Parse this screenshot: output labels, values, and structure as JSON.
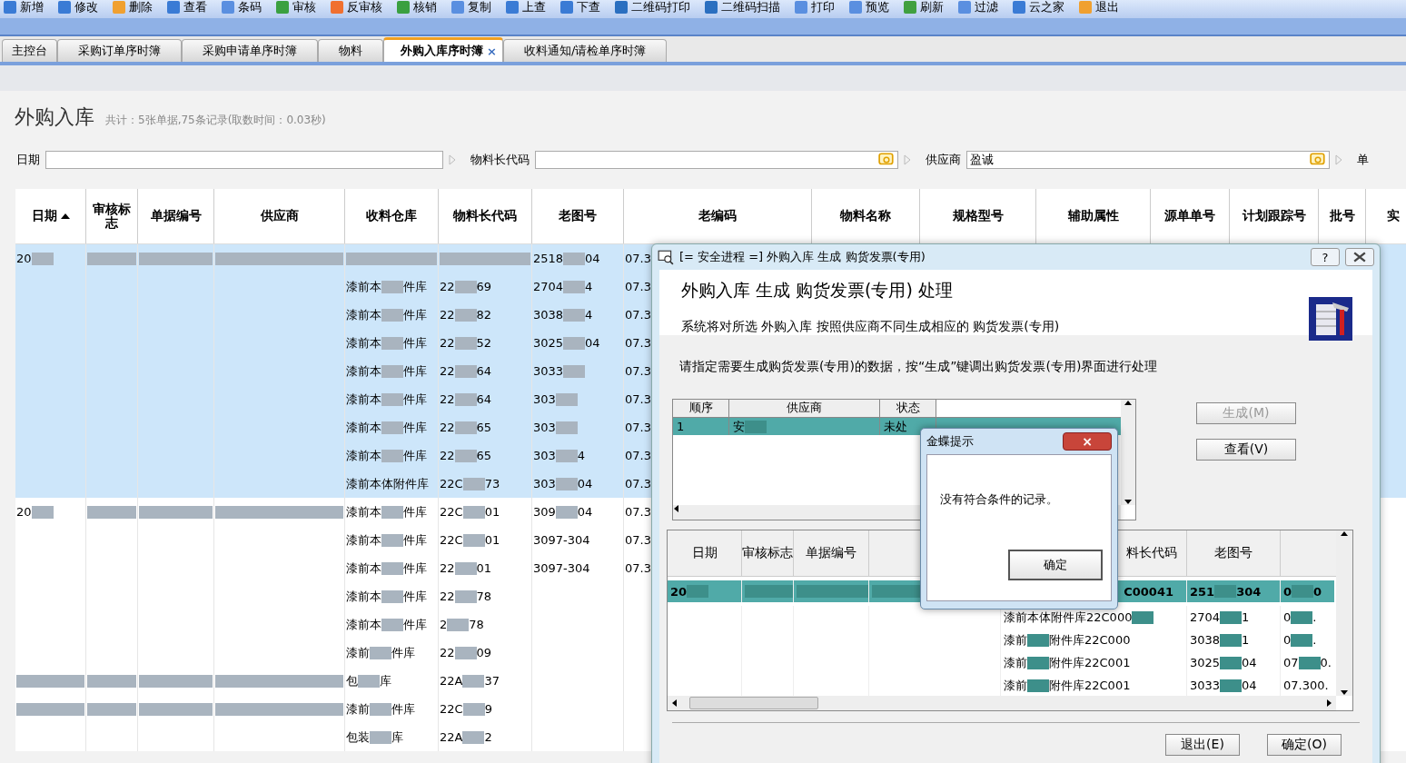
{
  "toolbar": [
    {
      "label": "新增",
      "color": "#3a7bd5"
    },
    {
      "label": "修改",
      "color": "#3a7bd5"
    },
    {
      "label": "删除",
      "color": "#f0a030"
    },
    {
      "label": "查看",
      "color": "#3a7bd5"
    },
    {
      "label": "条码",
      "color": "#5a8fe0"
    },
    {
      "label": "审核",
      "color": "#3aa040"
    },
    {
      "label": "反审核",
      "color": "#f07030"
    },
    {
      "label": "核销",
      "color": "#3aa040"
    },
    {
      "label": "复制",
      "color": "#5a8fe0"
    },
    {
      "label": "上查",
      "color": "#3a7bd5"
    },
    {
      "label": "下查",
      "color": "#3a7bd5"
    },
    {
      "label": "二维码打印",
      "color": "#2a6fc0"
    },
    {
      "label": "二维码扫描",
      "color": "#2a6fc0"
    },
    {
      "label": "打印",
      "color": "#5a8fe0"
    },
    {
      "label": "预览",
      "color": "#5a8fe0"
    },
    {
      "label": "刷新",
      "color": "#40a040"
    },
    {
      "label": "过滤",
      "color": "#5a8fe0"
    },
    {
      "label": "云之家",
      "color": "#3a7bd5"
    },
    {
      "label": "退出",
      "color": "#f0a030"
    }
  ],
  "tabs": [
    {
      "label": "主控台",
      "selected": false
    },
    {
      "label": "采购订单序时簿",
      "selected": false
    },
    {
      "label": "采购申请单序时簿",
      "selected": false
    },
    {
      "label": "物料",
      "selected": false
    },
    {
      "label": "外购入库序时簿",
      "selected": true,
      "close": "×"
    },
    {
      "label": "收料通知/请检单序时簿",
      "selected": false
    }
  ],
  "page": {
    "title": "外购入库",
    "summary": "共计：5张单据,75条记录(取数时间：0.03秒)"
  },
  "filters": [
    {
      "label": "日期",
      "lookup": false
    },
    {
      "label": "物料长代码",
      "lookup": true
    },
    {
      "label": "供应商",
      "value": "盈诚",
      "lookup": true
    },
    {
      "label": "单"
    }
  ],
  "table": {
    "columns": [
      {
        "label": "日期",
        "sorted": true
      },
      {
        "label": "审核标志",
        "sorted": false
      },
      {
        "label": "单据编号",
        "sorted": false
      },
      {
        "label": "供应商",
        "sorted": false
      },
      {
        "label": "收料仓库",
        "sorted": false
      },
      {
        "label": "物料长代码",
        "sorted": false
      },
      {
        "label": "老图号",
        "sorted": false
      },
      {
        "label": "老编码",
        "sorted": false
      },
      {
        "label": "物料名称",
        "sorted": false
      },
      {
        "label": "规格型号",
        "sorted": false
      },
      {
        "label": "辅助属性",
        "sorted": false
      },
      {
        "label": "源单单号",
        "sorted": false
      },
      {
        "label": "计划跟踪号",
        "sorted": false
      },
      {
        "label": "批号",
        "sorted": false
      },
      {
        "label": "实",
        "sorted": false
      }
    ],
    "rows": [
      {
        "selected": true,
        "cells": [
          {
            "parts": [
              "20"
            ],
            "blurred": true
          },
          {
            "blurred": true
          },
          {
            "blurred": true
          },
          {
            "blurred": true
          },
          {
            "blurred": true
          },
          {
            "blurred": true
          },
          {
            "parts": [
              "2518",
              "04"
            ],
            "blurred": true
          },
          {
            "parts": [
              "07.3"
            ],
            "blurred": false
          }
        ]
      },
      {
        "selected": true,
        "cells": [
          null,
          null,
          null,
          null,
          {
            "parts": [
              "漆前本",
              "件库"
            ],
            "blurred": true
          },
          {
            "parts": [
              "22",
              "69"
            ],
            "blurred": true
          },
          {
            "parts": [
              "2704",
              "4"
            ],
            "blurred": true
          },
          {
            "parts": [
              "07.3"
            ],
            "blurred": false
          }
        ]
      },
      {
        "selected": true,
        "cells": [
          null,
          null,
          null,
          null,
          {
            "parts": [
              "漆前本",
              "件库"
            ],
            "blurred": true
          },
          {
            "parts": [
              "22",
              "82"
            ],
            "blurred": true
          },
          {
            "parts": [
              "3038",
              "4"
            ],
            "blurred": true
          },
          {
            "parts": [
              "07.3"
            ],
            "blurred": false
          }
        ]
      },
      {
        "selected": true,
        "cells": [
          null,
          null,
          null,
          null,
          {
            "parts": [
              "漆前本",
              "件库"
            ],
            "blurred": true
          },
          {
            "parts": [
              "22",
              "52"
            ],
            "blurred": true
          },
          {
            "parts": [
              "3025",
              "04"
            ],
            "blurred": true
          },
          {
            "parts": [
              "07.3"
            ],
            "blurred": false
          }
        ]
      },
      {
        "selected": true,
        "cells": [
          null,
          null,
          null,
          null,
          {
            "parts": [
              "漆前本",
              "件库"
            ],
            "blurred": true
          },
          {
            "parts": [
              "22",
              "64"
            ],
            "blurred": true
          },
          {
            "parts": [
              "3033"
            ],
            "blurred": true
          },
          {
            "parts": [
              "07.3"
            ],
            "blurred": false
          }
        ]
      },
      {
        "selected": true,
        "cells": [
          null,
          null,
          null,
          null,
          {
            "parts": [
              "漆前本",
              "件库"
            ],
            "blurred": true
          },
          {
            "parts": [
              "22",
              "64"
            ],
            "blurred": true
          },
          {
            "parts": [
              "303"
            ],
            "blurred": true
          },
          {
            "parts": [
              "07.3"
            ],
            "blurred": false
          }
        ]
      },
      {
        "selected": true,
        "cells": [
          null,
          null,
          null,
          null,
          {
            "parts": [
              "漆前本",
              "件库"
            ],
            "blurred": true
          },
          {
            "parts": [
              "22",
              "65"
            ],
            "blurred": true
          },
          {
            "parts": [
              "303"
            ],
            "blurred": true
          },
          {
            "parts": [
              "07.3"
            ],
            "blurred": false
          }
        ]
      },
      {
        "selected": true,
        "cells": [
          null,
          null,
          null,
          null,
          {
            "parts": [
              "漆前本",
              "件库"
            ],
            "blurred": true
          },
          {
            "parts": [
              "22",
              "65"
            ],
            "blurred": true
          },
          {
            "parts": [
              "303",
              "4"
            ],
            "blurred": true
          },
          {
            "parts": [
              "07.3"
            ],
            "blurred": false
          }
        ]
      },
      {
        "selected": true,
        "cells": [
          null,
          null,
          null,
          null,
          {
            "parts": [
              "漆前本体附件库"
            ],
            "blurred": false
          },
          {
            "parts": [
              "22C",
              "73"
            ],
            "blurred": true
          },
          {
            "parts": [
              "303",
              "04"
            ],
            "blurred": true
          },
          {
            "parts": [
              "07.3"
            ],
            "blurred": false
          }
        ]
      },
      {
        "selected": false,
        "cells": [
          {
            "parts": [
              "20"
            ],
            "blurred": true
          },
          {
            "blurred": true
          },
          {
            "blurred": true
          },
          {
            "blurred": true
          },
          {
            "parts": [
              "漆前本",
              "件库"
            ],
            "blurred": true
          },
          {
            "parts": [
              "22C",
              "01"
            ],
            "blurred": true
          },
          {
            "parts": [
              "309",
              "04"
            ],
            "blurred": true
          },
          {
            "parts": [
              "07.3"
            ],
            "blurred": false
          }
        ]
      },
      {
        "selected": false,
        "cells": [
          null,
          null,
          null,
          null,
          {
            "parts": [
              "漆前本",
              "件库"
            ],
            "blurred": true
          },
          {
            "parts": [
              "22C",
              "01"
            ],
            "blurred": true
          },
          {
            "parts": [
              "3097-304"
            ],
            "blurred": false
          },
          {
            "parts": [
              "07.3"
            ],
            "blurred": false
          }
        ]
      },
      {
        "selected": false,
        "cells": [
          null,
          null,
          null,
          null,
          {
            "parts": [
              "漆前本",
              "件库"
            ],
            "blurred": true
          },
          {
            "parts": [
              "22",
              "01"
            ],
            "blurred": true
          },
          {
            "parts": [
              "3097-304"
            ],
            "blurred": false
          },
          {
            "parts": [
              "07.3"
            ],
            "blurred": false
          }
        ]
      },
      {
        "selected": false,
        "cells": [
          null,
          null,
          null,
          null,
          {
            "parts": [
              "漆前本",
              "件库"
            ],
            "blurred": true
          },
          {
            "parts": [
              "22",
              "78"
            ],
            "blurred": true
          },
          null,
          null
        ]
      },
      {
        "selected": false,
        "cells": [
          null,
          null,
          null,
          null,
          {
            "parts": [
              "漆前本",
              "件库"
            ],
            "blurred": true
          },
          {
            "parts": [
              "2",
              "78"
            ],
            "blurred": true
          },
          null,
          null
        ]
      },
      {
        "selected": false,
        "cells": [
          null,
          null,
          null,
          null,
          {
            "parts": [
              "漆前",
              "件库"
            ],
            "blurred": true
          },
          {
            "parts": [
              "22",
              "09"
            ],
            "blurred": true
          },
          null,
          null
        ]
      },
      {
        "selected": false,
        "cells": [
          {
            "blurred": true
          },
          {
            "blurred": true
          },
          {
            "blurred": true
          },
          {
            "blurred": true
          },
          {
            "parts": [
              "包",
              "库"
            ],
            "blurred": true
          },
          {
            "parts": [
              "22A",
              "37"
            ],
            "blurred": true
          },
          null,
          null
        ]
      },
      {
        "selected": false,
        "cells": [
          {
            "blurred": true
          },
          {
            "blurred": true
          },
          {
            "blurred": true
          },
          {
            "blurred": true
          },
          {
            "parts": [
              "漆前",
              "件库"
            ],
            "blurred": true
          },
          {
            "parts": [
              "22C",
              "9"
            ],
            "blurred": true
          },
          null,
          null
        ]
      },
      {
        "selected": false,
        "cells": [
          null,
          null,
          null,
          null,
          {
            "parts": [
              "包装",
              "库"
            ],
            "blurred": true
          },
          {
            "parts": [
              "22A",
              "2"
            ],
            "blurred": true
          },
          null,
          null
        ]
      }
    ]
  },
  "dialog": {
    "title": "[= 安全进程 =] 外购入库 生成 购货发票(专用)",
    "help": "?",
    "heading": "外购入库 生成 购货发票(专用) 处理",
    "description": "系统将对所选 外购入库 按照供应商不同生成相应的 购货发票(专用)",
    "instruction": "请指定需要生成购货发票(专用)的数据，按“生成”键调出购货发票(专用)界面进行处理",
    "source_grid": {
      "columns": [
        "顺序",
        "供应商",
        "状态"
      ],
      "rows": [
        {
          "selected": true,
          "cells": [
            {
              "parts": [
                "1"
              ],
              "blurred": false
            },
            {
              "parts": [
                "安"
              ],
              "blurred": true
            },
            {
              "parts": [
                "未处"
              ],
              "blurred": false
            }
          ]
        }
      ]
    },
    "buttons": [
      {
        "label": "生成(M)",
        "disabled": true
      },
      {
        "label": "查看(V)",
        "disabled": false
      }
    ],
    "detail_grid": {
      "columns": [
        "日期",
        "审核标志",
        "单据编号",
        null,
        "料长代码",
        "老图号",
        null
      ],
      "rows": [
        {
          "selected": true,
          "cells": [
            {
              "parts": [
                "20"
              ],
              "blurred": true
            },
            {
              "blurred": true
            },
            {
              "blurred": true
            },
            {
              "blurred": true
            },
            {
              "parts": [
                "C00041"
              ],
              "blurred": false
            },
            {
              "parts": [
                "251",
                "304"
              ],
              "blurred": true
            },
            {
              "parts": [
                "0",
                "0"
              ],
              "blurred": true
            }
          ]
        },
        {
          "selected": false,
          "cells": [
            null,
            null,
            null,
            null,
            {
              "parts": [
                "漆前本体附件库22C000"
              ],
              "blurred": true
            },
            {
              "parts": [
                "2704",
                "1"
              ],
              "blurred": true
            },
            {
              "parts": [
                "0",
                "."
              ],
              "blurred": true
            }
          ]
        },
        {
          "selected": false,
          "cells": [
            null,
            null,
            null,
            null,
            {
              "parts": [
                "漆前",
                "附件库22C000"
              ],
              "blurred": true
            },
            {
              "parts": [
                "3038",
                "1"
              ],
              "blurred": true
            },
            {
              "parts": [
                "0",
                "."
              ],
              "blurred": true
            }
          ]
        },
        {
          "selected": false,
          "cells": [
            null,
            null,
            null,
            null,
            {
              "parts": [
                "漆前",
                "附件库22C001"
              ],
              "blurred": true
            },
            {
              "parts": [
                "3025",
                "04"
              ],
              "blurred": true
            },
            {
              "parts": [
                "07",
                "0."
              ],
              "blurred": true
            }
          ]
        },
        {
          "selected": false,
          "cells": [
            null,
            null,
            null,
            null,
            {
              "parts": [
                "漆前",
                "附件库22C001"
              ],
              "blurred": true
            },
            {
              "parts": [
                "3033",
                "04"
              ],
              "blurred": true
            },
            {
              "parts": [
                "07.300."
              ],
              "blurred": false
            }
          ]
        }
      ]
    },
    "footer_buttons": [
      "退出(E)",
      "确定(O)"
    ]
  },
  "message_box": {
    "title": "金蝶提示",
    "close": "×",
    "message": "没有符合条件的记录。",
    "button": "确定"
  }
}
